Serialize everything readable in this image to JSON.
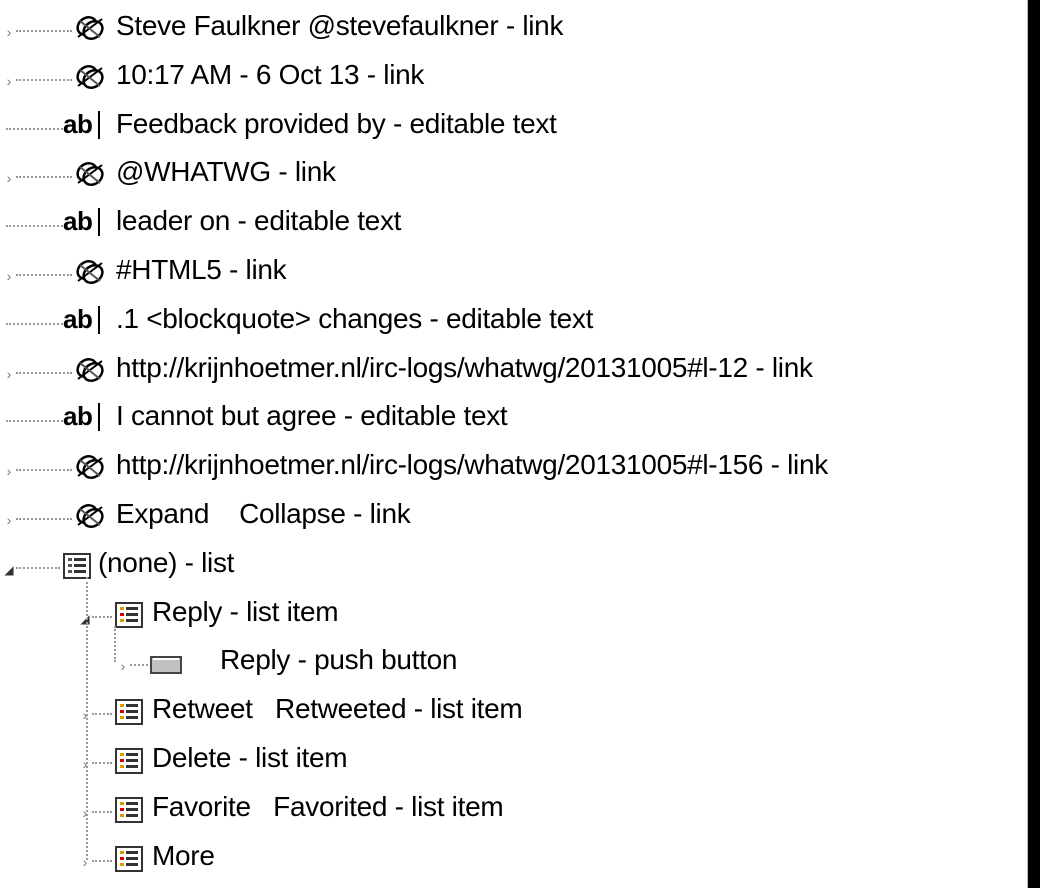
{
  "tree": {
    "items": [
      {
        "label": "Steve Faulkner @stevefaulkner - link",
        "icon": "link-icon",
        "level": 0,
        "state": "collapsed"
      },
      {
        "label": "10:17 AM - 6 Oct 13 - link",
        "icon": "link-icon",
        "level": 0,
        "state": "collapsed"
      },
      {
        "label": "Feedback provided by - editable text",
        "icon": "editable-text-icon",
        "level": 0,
        "state": "leaf"
      },
      {
        "label": "@WHATWG - link",
        "icon": "link-icon",
        "level": 0,
        "state": "collapsed"
      },
      {
        "label": "leader on - editable text",
        "icon": "editable-text-icon",
        "level": 0,
        "state": "leaf"
      },
      {
        "label": "#HTML5 - link",
        "icon": "link-icon",
        "level": 0,
        "state": "collapsed"
      },
      {
        "label": ".1 <blockquote> changes - editable text",
        "icon": "editable-text-icon",
        "level": 0,
        "state": "leaf"
      },
      {
        "label": "http://krijnhoetmer.nl/irc-logs/whatwg/20131005#l-12 - link",
        "icon": "link-icon",
        "level": 0,
        "state": "collapsed"
      },
      {
        "label": "I cannot but agree - editable text",
        "icon": "editable-text-icon",
        "level": 0,
        "state": "leaf"
      },
      {
        "label": "http://krijnhoetmer.nl/irc-logs/whatwg/20131005#l-156 - link",
        "icon": "link-icon",
        "level": 0,
        "state": "collapsed"
      },
      {
        "label": "Expand    Collapse - link",
        "icon": "link-icon",
        "level": 0,
        "state": "collapsed"
      },
      {
        "label": "(none) - list",
        "icon": "list-icon",
        "level": 0,
        "state": "expanded"
      },
      {
        "label": "Reply - list item",
        "icon": "list-item-icon",
        "level": 1,
        "state": "expanded"
      },
      {
        "label": "Reply - push button",
        "icon": "push-button-icon",
        "level": 2,
        "state": "collapsed"
      },
      {
        "label": "Retweet   Retweeted - list item",
        "icon": "list-item-icon",
        "level": 1,
        "state": "collapsed"
      },
      {
        "label": "Delete - list item",
        "icon": "list-item-icon",
        "level": 1,
        "state": "collapsed"
      },
      {
        "label": "Favorite   Favorited - list item",
        "icon": "list-item-icon",
        "level": 1,
        "state": "collapsed"
      },
      {
        "label": "More",
        "icon": "list-item-icon",
        "level": 1,
        "state": "collapsed"
      }
    ],
    "editable_icon_text": "ab"
  }
}
